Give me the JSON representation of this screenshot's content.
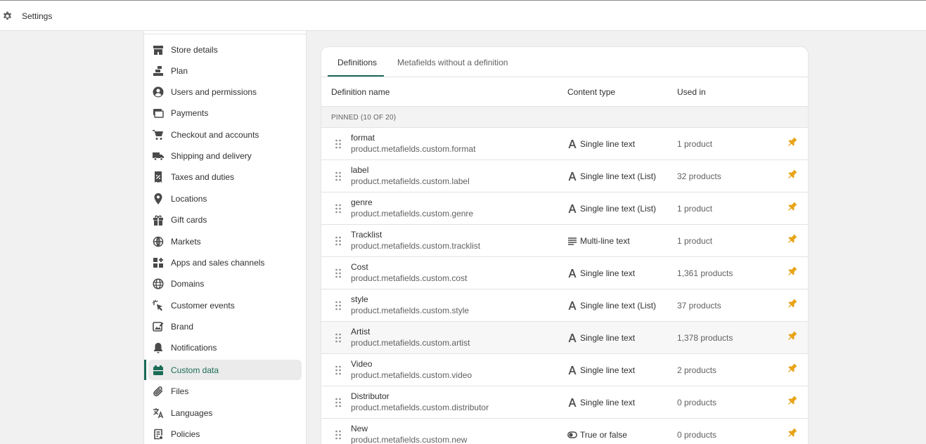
{
  "app": {
    "title": "Settings",
    "title_icon": "gear-icon"
  },
  "sidebar": {
    "items": [
      {
        "label": "Store details",
        "icon": "store-icon",
        "active": false
      },
      {
        "label": "Plan",
        "icon": "plan-icon",
        "active": false
      },
      {
        "label": "Users and permissions",
        "icon": "user-icon",
        "active": false
      },
      {
        "label": "Payments",
        "icon": "payments-icon",
        "active": false
      },
      {
        "label": "Checkout and accounts",
        "icon": "cart-icon",
        "active": false
      },
      {
        "label": "Shipping and delivery",
        "icon": "truck-icon",
        "active": false
      },
      {
        "label": "Taxes and duties",
        "icon": "tax-icon",
        "active": false
      },
      {
        "label": "Locations",
        "icon": "location-pin-icon",
        "active": false
      },
      {
        "label": "Gift cards",
        "icon": "gift-icon",
        "active": false
      },
      {
        "label": "Markets",
        "icon": "markets-icon",
        "active": false
      },
      {
        "label": "Apps and sales channels",
        "icon": "apps-icon",
        "active": false
      },
      {
        "label": "Domains",
        "icon": "globe-icon",
        "active": false
      },
      {
        "label": "Customer events",
        "icon": "cursor-click-icon",
        "active": false
      },
      {
        "label": "Brand",
        "icon": "brand-icon",
        "active": false
      },
      {
        "label": "Notifications",
        "icon": "bell-icon",
        "active": false
      },
      {
        "label": "Custom data",
        "icon": "custom-data-icon",
        "active": true
      },
      {
        "label": "Files",
        "icon": "paperclip-icon",
        "active": false
      },
      {
        "label": "Languages",
        "icon": "translate-icon",
        "active": false
      },
      {
        "label": "Policies",
        "icon": "policy-icon",
        "active": false
      }
    ]
  },
  "main": {
    "tabs": [
      {
        "label": "Definitions",
        "active": true
      },
      {
        "label": "Metafields without a definition",
        "active": false
      }
    ],
    "columns": {
      "name": "Definition name",
      "type": "Content type",
      "used": "Used in"
    },
    "section_label": "PINNED (10 OF 20)",
    "rows": [
      {
        "name": "format",
        "key": "product.metafields.custom.format",
        "type": "Single line text",
        "type_icon": "text-a-icon",
        "used": "1 product",
        "pinned": true
      },
      {
        "name": "label",
        "key": "product.metafields.custom.label",
        "type": "Single line text (List)",
        "type_icon": "text-a-icon",
        "used": "32 products",
        "pinned": true
      },
      {
        "name": "genre",
        "key": "product.metafields.custom.genre",
        "type": "Single line text (List)",
        "type_icon": "text-a-icon",
        "used": "1 product",
        "pinned": true
      },
      {
        "name": "Tracklist",
        "key": "product.metafields.custom.tracklist",
        "type": "Multi-line text",
        "type_icon": "multiline-text-icon",
        "used": "1 product",
        "pinned": true
      },
      {
        "name": "Cost",
        "key": "product.metafields.custom.cost",
        "type": "Single line text",
        "type_icon": "text-a-icon",
        "used": "1,361 products",
        "pinned": true
      },
      {
        "name": "style",
        "key": "product.metafields.custom.style",
        "type": "Single line text (List)",
        "type_icon": "text-a-icon",
        "used": "37 products",
        "pinned": true
      },
      {
        "name": "Artist",
        "key": "product.metafields.custom.artist",
        "type": "Single line text",
        "type_icon": "text-a-icon",
        "used": "1,378 products",
        "pinned": true
      },
      {
        "name": "Video",
        "key": "product.metafields.custom.video",
        "type": "Single line text",
        "type_icon": "text-a-icon",
        "used": "2 products",
        "pinned": true
      },
      {
        "name": "Distributor",
        "key": "product.metafields.custom.distributor",
        "type": "Single line text",
        "type_icon": "text-a-icon",
        "used": "0 products",
        "pinned": true
      },
      {
        "name": "New",
        "key": "product.metafields.custom.new",
        "type": "True or false",
        "type_icon": "toggle-icon",
        "used": "0 products",
        "pinned": true
      }
    ]
  },
  "colors": {
    "accent": "#1a6b56",
    "pin": "#e8a317",
    "page_bg": "#f1f1f1",
    "card_bg": "#ffffff"
  }
}
